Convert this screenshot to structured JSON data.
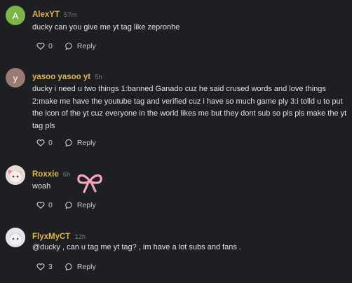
{
  "colors": {
    "background": "#1e1f22",
    "username": "#e0b64a",
    "timestamp": "#7b7d84",
    "text": "#e2e2e2",
    "action": "#c8c9cc"
  },
  "comments": [
    {
      "avatar_letter": "A",
      "avatar_color": "#7ab648",
      "username": "AlexYT",
      "time": "57m",
      "text": "ducky can you give me yt tag like zepronhe",
      "likes": "0",
      "reply_label": "Reply"
    },
    {
      "avatar_letter": "y",
      "avatar_color": "#9a7b73",
      "username": "yasoo yasoo yt",
      "time": "5h",
      "text": "ducky i need u two things 1:banned Ganado cuz he said crused words and love things 2:make me have the youtube tag and verified cuz i have so much game ply 3:i tolld u to put the icon of the yt cuz everyone in the world likes me but they dont sub so pls pls make the yt tag pls",
      "likes": "0",
      "reply_label": "Reply"
    },
    {
      "avatar_icon": "anime-avatar-icon",
      "username": "Roxxie",
      "time": "6h",
      "text": "woah",
      "likes": "0",
      "reply_label": "Reply",
      "sticker": "pink-bow-sticker"
    },
    {
      "avatar_icon": "anime-avatar-icon",
      "username": "FlyxMyCT",
      "time": "12h",
      "text": "@ducky , can u tag me yt tag? , im have a lot subs and fans .",
      "likes": "3",
      "reply_label": "Reply"
    }
  ],
  "icons": {
    "like": "heart-icon",
    "reply": "speech-bubble-icon"
  }
}
